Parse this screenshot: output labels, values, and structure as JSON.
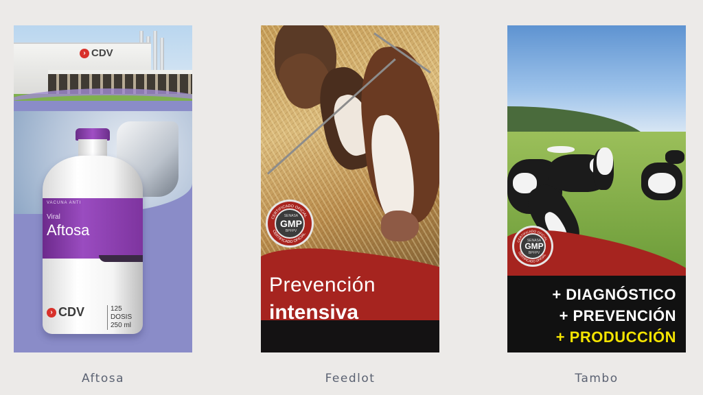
{
  "cards": [
    {
      "caption": "Aftosa",
      "building_logo": "CDV",
      "bottle": {
        "small_text": "VACUNA ANTI",
        "viral_text": "Viral",
        "product_name": "Aftosa",
        "brand": "CDV",
        "doses": "125 DOSIS",
        "volume": "250 ml"
      }
    },
    {
      "caption": "Feedlot",
      "title_line1": "Prevención",
      "title_line2": "intensiva",
      "seal": {
        "top_text": "CERTIFICADO OFICIAL",
        "org": "SENASA",
        "mark": "GMP",
        "sub": "BPFPV",
        "bottom_text": "CERTIFICADO OFICIAL"
      }
    },
    {
      "caption": "Tambo",
      "lines": [
        "+ DIAGNÓSTICO",
        "+ PREVENCIÓN",
        "+ PRODUCCIÓN"
      ],
      "seal": {
        "top_text": "CERTIFICADO OFICIAL",
        "org": "SENASA",
        "mark": "GMP",
        "sub": "BPFPV",
        "bottom_text": "CERTIFICADO OFICIAL"
      }
    }
  ],
  "colors": {
    "background": "#eceae8",
    "caption": "#5b6272",
    "brand_red": "#a6241f",
    "aftosa_purple": "#7e349f",
    "tambo_highlight": "#f4e400"
  }
}
